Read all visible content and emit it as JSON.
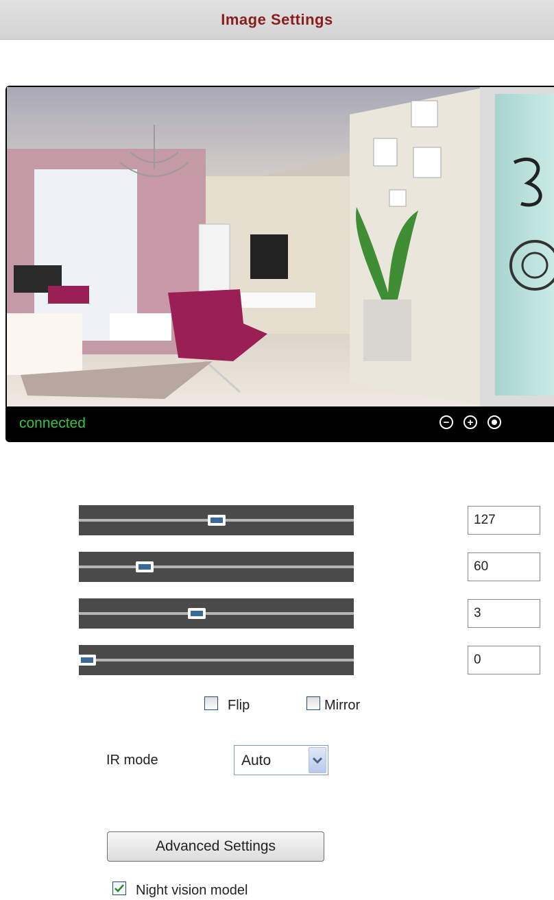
{
  "header": {
    "title": "Image Settings"
  },
  "video": {
    "status": "connected",
    "controls": [
      {
        "name": "zoom-out-icon",
        "glyph": "−"
      },
      {
        "name": "zoom-in-icon",
        "glyph": "+"
      },
      {
        "name": "record-icon",
        "glyph": ""
      }
    ]
  },
  "sliders": [
    {
      "name": "brightness",
      "value": "127",
      "level": 0.5
    },
    {
      "name": "contrast",
      "value": "60",
      "level": 0.24
    },
    {
      "name": "hue",
      "value": "3",
      "level": 0.43
    },
    {
      "name": "saturation",
      "value": "0",
      "level": 0.03
    }
  ],
  "options": {
    "flip": "Flip",
    "mirror": "Mirror"
  },
  "ir": {
    "label": "IR mode",
    "selected": "Auto"
  },
  "advanced": {
    "label": "Advanced Settings"
  },
  "night": {
    "label": "Night vision model",
    "checked": true
  }
}
